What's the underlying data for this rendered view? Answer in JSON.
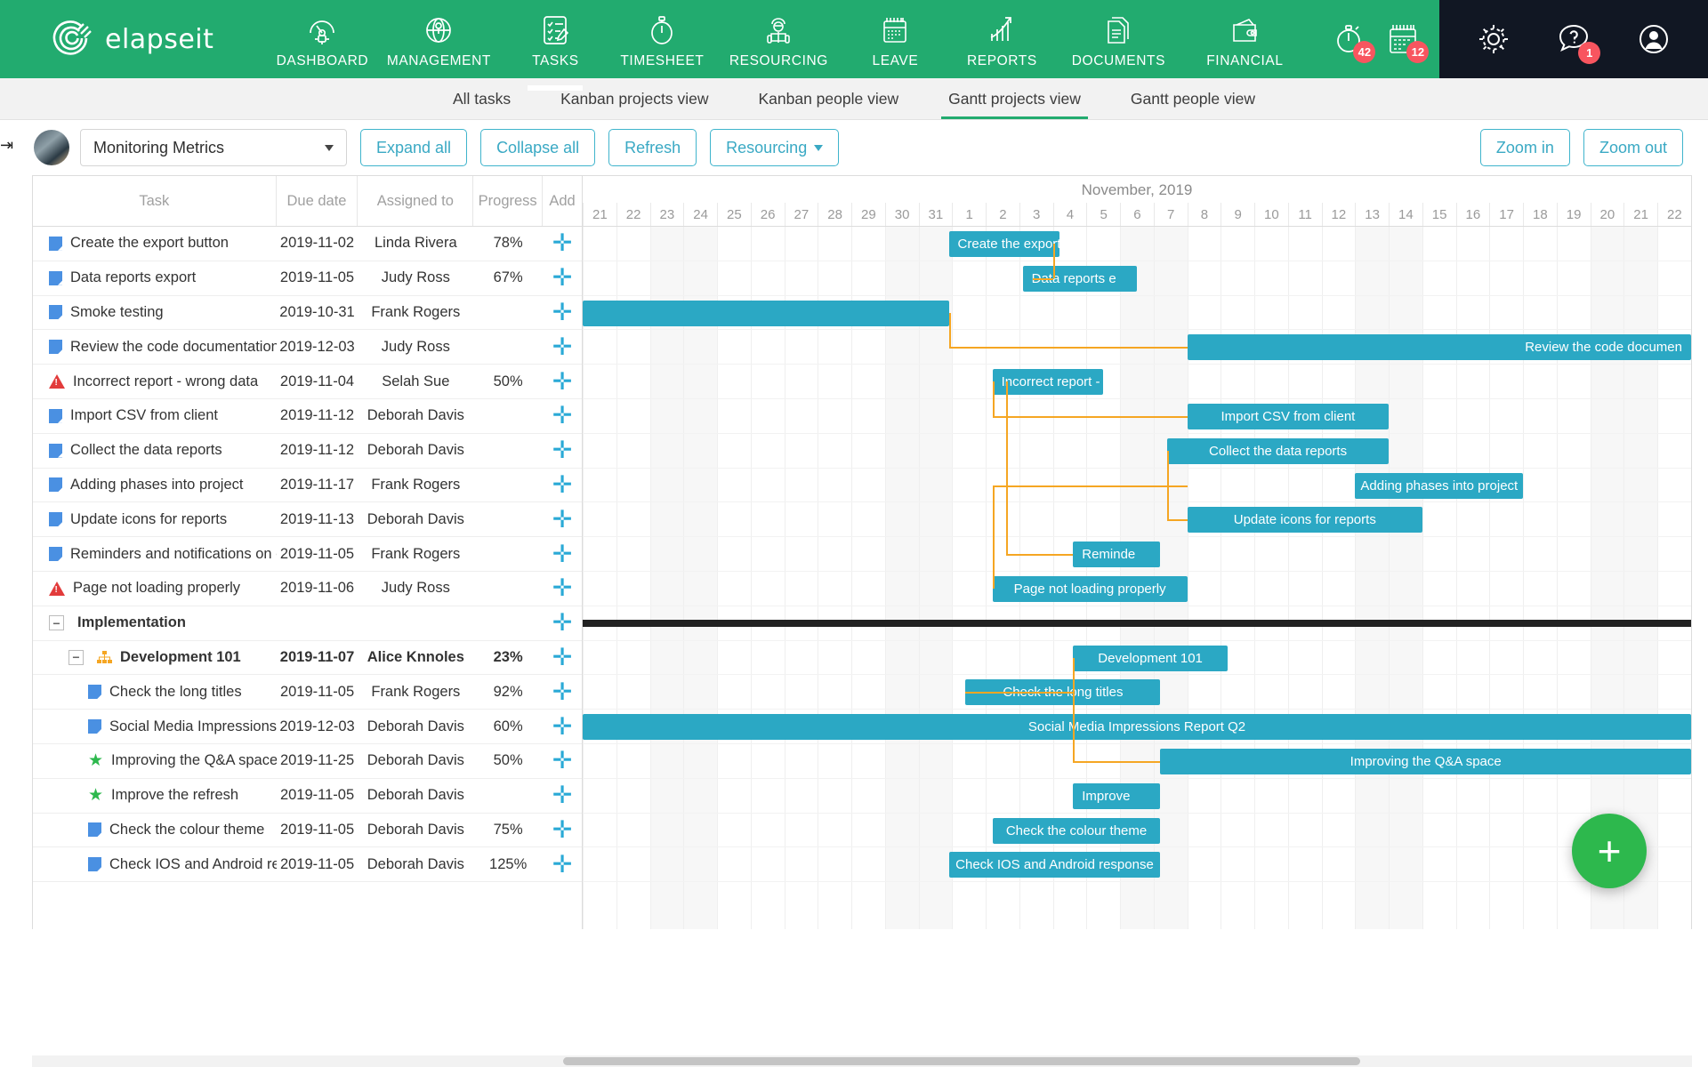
{
  "brand": {
    "name": "elapseit",
    "logo_icon": "elapseit-swirl-logo",
    "green": "#22ab6f",
    "teal": "#2ba8c4",
    "dark": "#111723"
  },
  "topnav": {
    "items": [
      {
        "label": "DASHBOARD",
        "icon": "gauge-icon",
        "active": false
      },
      {
        "label": "MANAGEMENT",
        "icon": "globe-pin-icon",
        "active": false
      },
      {
        "label": "TASKS",
        "icon": "checklist-pencil-icon",
        "active": true
      },
      {
        "label": "TIMESHEET",
        "icon": "stopwatch-icon",
        "active": false
      },
      {
        "label": "RESOURCING",
        "icon": "person-resource-icon",
        "active": false
      },
      {
        "label": "LEAVE",
        "icon": "calendar-icon",
        "active": false
      },
      {
        "label": "REPORTS",
        "icon": "bar-chart-arrow-icon",
        "active": false
      },
      {
        "label": "DOCUMENTS",
        "icon": "documents-icon",
        "active": false
      },
      {
        "label": "FINANCIAL",
        "icon": "wallet-icon",
        "active": false
      }
    ],
    "alerts": [
      {
        "icon": "stopwatch-alert-icon",
        "badge": "42"
      },
      {
        "icon": "calendar-alert-icon",
        "badge": "12"
      }
    ],
    "right": [
      {
        "icon": "gear-icon",
        "badge": ""
      },
      {
        "icon": "help-chat-icon",
        "badge": "1"
      },
      {
        "icon": "user-avatar-icon",
        "badge": ""
      }
    ]
  },
  "subtabs": [
    {
      "label": "All tasks",
      "active": false
    },
    {
      "label": "Kanban projects view",
      "active": false
    },
    {
      "label": "Kanban people view",
      "active": false
    },
    {
      "label": "Gantt projects view",
      "active": true
    },
    {
      "label": "Gantt people view",
      "active": false
    }
  ],
  "toolbar": {
    "project_value": "Monitoring Metrics",
    "expand_all": "Expand all",
    "collapse_all": "Collapse all",
    "refresh": "Refresh",
    "resourcing": "Resourcing",
    "zoom_in": "Zoom in",
    "zoom_out": "Zoom out"
  },
  "table": {
    "headers": [
      "Task",
      "Due date",
      "Assigned to",
      "Progress",
      "Add"
    ],
    "add_symbol": "✛"
  },
  "chart_data": {
    "type": "gantt",
    "title": "Gantt projects view — Monitoring Metrics",
    "month_label": "November, 2019",
    "axis_days": [
      "21",
      "22",
      "23",
      "24",
      "25",
      "26",
      "27",
      "28",
      "29",
      "30",
      "31",
      "1",
      "2",
      "3",
      "4",
      "5",
      "6",
      "7",
      "8",
      "9",
      "10",
      "11",
      "12",
      "13",
      "14",
      "15",
      "16",
      "17",
      "18",
      "19",
      "20",
      "21",
      "22"
    ],
    "weekend_columns": [
      2,
      3,
      9,
      10,
      16,
      17,
      23,
      24,
      30,
      31
    ],
    "rows": [
      {
        "task": "Create the export button",
        "icon": "doc-icon",
        "due": "2019-11-02",
        "assignee": "Linda Rivera",
        "progress": "78%",
        "indent": 0,
        "type": "task",
        "bar": {
          "start": 10.9,
          "end": 14.2,
          "label": "Create the export",
          "align": "left"
        }
      },
      {
        "task": "Data reports export",
        "icon": "doc-icon",
        "due": "2019-11-05",
        "assignee": "Judy Ross",
        "progress": "67%",
        "indent": 0,
        "type": "task",
        "bar": {
          "start": 13.1,
          "end": 16.5,
          "label": "Data reports e",
          "align": "left"
        }
      },
      {
        "task": "Smoke testing",
        "icon": "doc-icon",
        "due": "2019-10-31",
        "assignee": "Frank Rogers",
        "progress": "",
        "indent": 0,
        "type": "task",
        "bar": {
          "start": 0,
          "end": 10.9,
          "label": "",
          "align": "left"
        }
      },
      {
        "task": "Review the code documentation",
        "icon": "doc-icon",
        "due": "2019-12-03",
        "assignee": "Judy Ross",
        "progress": "",
        "indent": 0,
        "type": "task",
        "bar": {
          "start": 18.0,
          "end": 33,
          "label": "Review the code documen",
          "align": "right"
        }
      },
      {
        "task": "Incorrect report - wrong data",
        "icon": "warning-icon",
        "due": "2019-11-04",
        "assignee": "Selah Sue",
        "progress": "50%",
        "indent": 0,
        "type": "task",
        "bar": {
          "start": 12.2,
          "end": 15.5,
          "label": "Incorrect report - w",
          "align": "left"
        }
      },
      {
        "task": "Import CSV from client",
        "icon": "doc-icon",
        "due": "2019-11-12",
        "assignee": "Deborah Davis",
        "progress": "",
        "indent": 0,
        "type": "task",
        "bar": {
          "start": 18.0,
          "end": 24.0,
          "label": "Import CSV from client",
          "align": "center"
        }
      },
      {
        "task": "Collect the data reports",
        "icon": "doc-icon",
        "due": "2019-11-12",
        "assignee": "Deborah Davis",
        "progress": "",
        "indent": 0,
        "type": "task",
        "bar": {
          "start": 17.4,
          "end": 24.0,
          "label": "Collect the data reports",
          "align": "center"
        }
      },
      {
        "task": "Adding phases into project",
        "icon": "doc-icon",
        "due": "2019-11-17",
        "assignee": "Frank Rogers",
        "progress": "",
        "indent": 0,
        "type": "task",
        "bar": {
          "start": 23.0,
          "end": 28.0,
          "label": "Adding phases into project",
          "align": "center"
        }
      },
      {
        "task": "Update icons for reports",
        "icon": "doc-icon",
        "due": "2019-11-13",
        "assignee": "Deborah Davis",
        "progress": "",
        "indent": 0,
        "type": "task",
        "bar": {
          "start": 18.0,
          "end": 25.0,
          "label": "Update icons for reports",
          "align": "center"
        }
      },
      {
        "task": "Reminders and notifications on en",
        "icon": "doc-icon",
        "due": "2019-11-05",
        "assignee": "Frank Rogers",
        "progress": "",
        "indent": 0,
        "type": "task",
        "bar": {
          "start": 14.6,
          "end": 17.2,
          "label": "Reminde",
          "align": "left"
        }
      },
      {
        "task": "Page not loading properly",
        "icon": "warning-icon",
        "due": "2019-11-06",
        "assignee": "Judy Ross",
        "progress": "",
        "indent": 0,
        "type": "task",
        "bar": {
          "start": 12.2,
          "end": 18.0,
          "label": "Page not loading properly",
          "align": "center"
        }
      },
      {
        "task": "Implementation",
        "icon": "",
        "due": "",
        "assignee": "",
        "progress": "",
        "indent": 0,
        "type": "group",
        "bar": {
          "start": 0,
          "end": 33,
          "label": "",
          "align": "left"
        }
      },
      {
        "task": "Development 101",
        "icon": "org-icon",
        "due": "2019-11-07",
        "assignee": "Alice Knnoles",
        "progress": "23%",
        "indent": 1,
        "type": "subgroup",
        "bar": {
          "start": 14.6,
          "end": 19.2,
          "label": "Development 101",
          "align": "center"
        }
      },
      {
        "task": "Check the long titles",
        "icon": "doc-icon",
        "due": "2019-11-05",
        "assignee": "Frank Rogers",
        "progress": "92%",
        "indent": 2,
        "type": "task",
        "bar": {
          "start": 11.4,
          "end": 17.2,
          "label": "Check the long titles",
          "align": "center"
        }
      },
      {
        "task": "Social Media Impressions Re",
        "icon": "doc-icon",
        "due": "2019-12-03",
        "assignee": "Deborah Davis",
        "progress": "60%",
        "indent": 2,
        "type": "task",
        "bar": {
          "start": 0,
          "end": 33,
          "label": "Social Media Impressions Report Q2",
          "align": "center"
        }
      },
      {
        "task": "Improving the Q&A space",
        "icon": "star-icon",
        "due": "2019-11-25",
        "assignee": "Deborah Davis",
        "progress": "50%",
        "indent": 2,
        "type": "task",
        "bar": {
          "start": 17.2,
          "end": 33,
          "label": "Improving the Q&A space",
          "align": "center"
        }
      },
      {
        "task": "Improve the refresh",
        "icon": "star-icon",
        "due": "2019-11-05",
        "assignee": "Deborah Davis",
        "progress": "",
        "indent": 2,
        "type": "task",
        "bar": {
          "start": 14.6,
          "end": 17.2,
          "label": "Improve",
          "align": "left"
        }
      },
      {
        "task": "Check the colour theme",
        "icon": "doc-icon",
        "due": "2019-11-05",
        "assignee": "Deborah Davis",
        "progress": "75%",
        "indent": 2,
        "type": "task",
        "bar": {
          "start": 12.2,
          "end": 17.2,
          "label": "Check the colour theme",
          "align": "center"
        }
      },
      {
        "task": "Check IOS and Android resp",
        "icon": "doc-icon",
        "due": "2019-11-05",
        "assignee": "Deborah Davis",
        "progress": "125%",
        "indent": 2,
        "type": "task",
        "bar": {
          "start": 10.9,
          "end": 17.2,
          "label": "Check IOS and Android response",
          "align": "center"
        }
      }
    ]
  },
  "fab": {
    "label": "+",
    "icon": "plus-icon"
  }
}
